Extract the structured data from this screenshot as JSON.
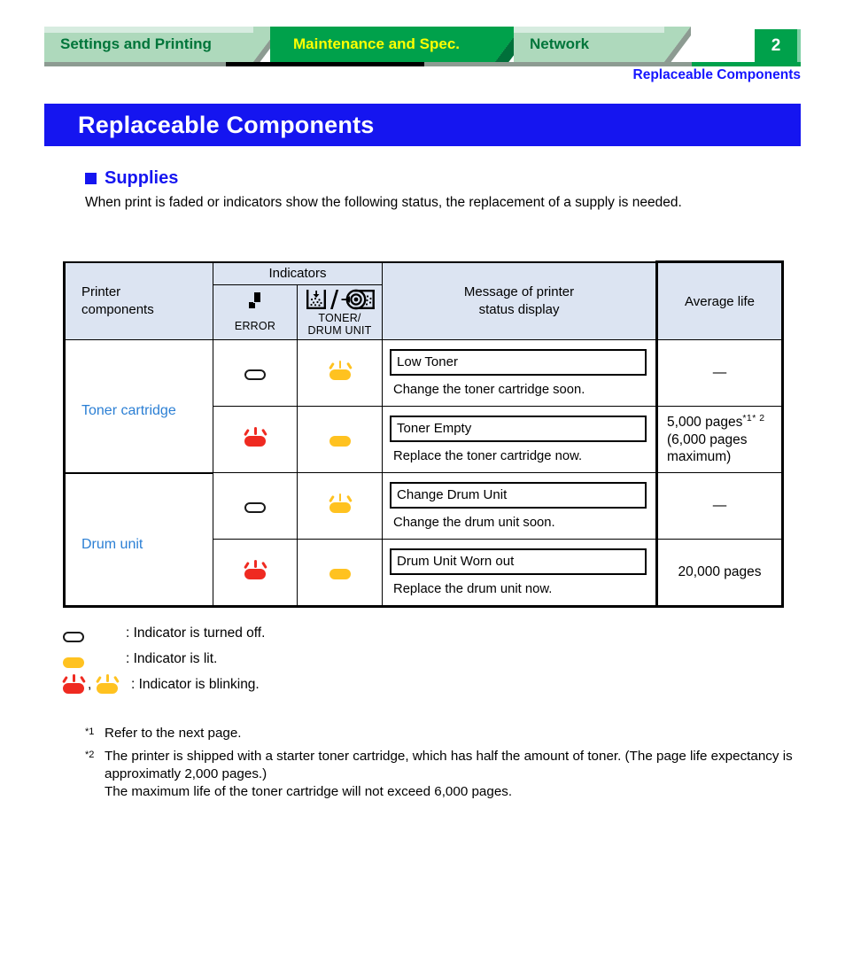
{
  "header": {
    "tabs": [
      {
        "label": "Settings and Printing",
        "active": false
      },
      {
        "label": "Maintenance and Spec.",
        "active": true
      },
      {
        "label": "Network",
        "active": false
      }
    ],
    "page_number": "2",
    "running_head": "Replaceable Components"
  },
  "title_banner": {
    "text": "Replaceable Components"
  },
  "section": {
    "heading": "Supplies",
    "intro": "When print is faded or indicators show the following status, the replacement of a supply is needed."
  },
  "table": {
    "headers": {
      "printer_components": "Printer\ncomponents",
      "indicators": "Indicators",
      "error": "ERROR",
      "toner_drum_line1": "TONER/",
      "toner_drum_line2": "DRUM UNIT",
      "message": "Message of printer\nstatus display",
      "average_life": "Average life"
    },
    "rows": [
      {
        "component": "Toner cartridge",
        "error_state": "off",
        "toner_state": "blink-amber",
        "message": "Low Toner",
        "message_sub": "Change the toner cartridge soon.",
        "life": "—",
        "life_extra": "",
        "life_note": ""
      },
      {
        "component": "",
        "error_state": "blink-red",
        "toner_state": "lit",
        "message": "Toner Empty",
        "message_sub": "Replace the toner cartridge now.",
        "life": "5,000 pages",
        "life_note": "*1* 2",
        "life_extra": "(6,000 pages\n maximum)"
      },
      {
        "component": "Drum unit",
        "error_state": "off",
        "toner_state": "blink-amber",
        "message": "Change Drum Unit",
        "message_sub": "Change the drum unit soon.",
        "life": "—",
        "life_extra": "",
        "life_note": ""
      },
      {
        "component": "",
        "error_state": "blink-red",
        "toner_state": "lit",
        "message": "Drum Unit Worn out",
        "message_sub": "Replace the drum unit now.",
        "life": "20,000 pages",
        "life_extra": "",
        "life_note": ""
      }
    ]
  },
  "legend": [
    {
      "icons": [
        "off"
      ],
      "text": ": Indicator is turned off."
    },
    {
      "icons": [
        "lit"
      ],
      "text": ": Indicator is lit."
    },
    {
      "icons": [
        "blink-red",
        "blink-amber"
      ],
      "text": ": Indicator is blinking."
    }
  ],
  "footnotes": [
    {
      "mark": "*1",
      "text": "Refer to the next page."
    },
    {
      "mark": "*2",
      "text": "The printer is shipped with a starter toner cartridge, which has half the amount of toner. (The page life expectancy is approximatly 2,000 pages.)\nThe maximum life of the toner cartridge will not exceed 6,000 pages."
    }
  ],
  "colors": {
    "tab_active_bg": "#00a14b",
    "tab_active_text": "#ffff00",
    "tab_inactive_bg": "#aed9bc",
    "tab_inactive_text": "#00753a",
    "banner_bg": "#1515f0",
    "heading_blue": "#1515f0",
    "component_blue": "#2b7fd4",
    "table_header_bg": "#dce4f2",
    "lamp_amber": "#ffc220",
    "lamp_red": "#ef2a21"
  }
}
